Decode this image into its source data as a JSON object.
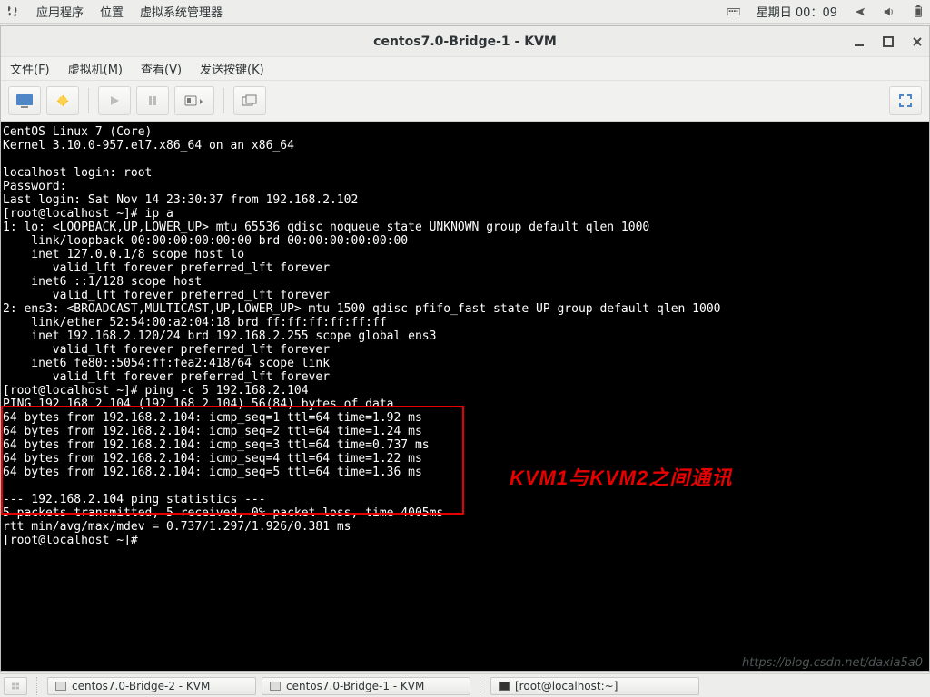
{
  "panel": {
    "app_menu": "应用程序",
    "places": "位置",
    "vmm": "虚拟系统管理器",
    "clock": "星期日 00：09"
  },
  "window": {
    "title": "centos7.0-Bridge-1 - KVM",
    "menus": {
      "file": "文件(F)",
      "vm": "虚拟机(M)",
      "view": "查看(V)",
      "sendkey": "发送按键(K)"
    }
  },
  "terminal_text": "CentOS Linux 7 (Core)\nKernel 3.10.0-957.el7.x86_64 on an x86_64\n\nlocalhost login: root\nPassword:\nLast login: Sat Nov 14 23:30:37 from 192.168.2.102\n[root@localhost ~]# ip a\n1: lo: <LOOPBACK,UP,LOWER_UP> mtu 65536 qdisc noqueue state UNKNOWN group default qlen 1000\n    link/loopback 00:00:00:00:00:00 brd 00:00:00:00:00:00\n    inet 127.0.0.1/8 scope host lo\n       valid_lft forever preferred_lft forever\n    inet6 ::1/128 scope host\n       valid_lft forever preferred_lft forever\n2: ens3: <BROADCAST,MULTICAST,UP,LOWER_UP> mtu 1500 qdisc pfifo_fast state UP group default qlen 1000\n    link/ether 52:54:00:a2:04:18 brd ff:ff:ff:ff:ff:ff\n    inet 192.168.2.120/24 brd 192.168.2.255 scope global ens3\n       valid_lft forever preferred_lft forever\n    inet6 fe80::5054:ff:fea2:418/64 scope link\n       valid_lft forever preferred_lft forever\n[root@localhost ~]# ping -c 5 192.168.2.104\nPING 192.168.2.104 (192.168.2.104) 56(84) bytes of data.\n64 bytes from 192.168.2.104: icmp_seq=1 ttl=64 time=1.92 ms\n64 bytes from 192.168.2.104: icmp_seq=2 ttl=64 time=1.24 ms\n64 bytes from 192.168.2.104: icmp_seq=3 ttl=64 time=0.737 ms\n64 bytes from 192.168.2.104: icmp_seq=4 ttl=64 time=1.22 ms\n64 bytes from 192.168.2.104: icmp_seq=5 ttl=64 time=1.36 ms\n\n--- 192.168.2.104 ping statistics ---\n5 packets transmitted, 5 received, 0% packet loss, time 4005ms\nrtt min/avg/max/mdev = 0.737/1.297/1.926/0.381 ms\n[root@localhost ~]# ",
  "annotation": "KVM1与KVM2之间通讯",
  "watermark": "https://blog.csdn.net/daxia5a0",
  "taskbar": {
    "task1": "centos7.0-Bridge-2 - KVM",
    "task2": "centos7.0-Bridge-1 - KVM",
    "task3": "[root@localhost:~]"
  }
}
